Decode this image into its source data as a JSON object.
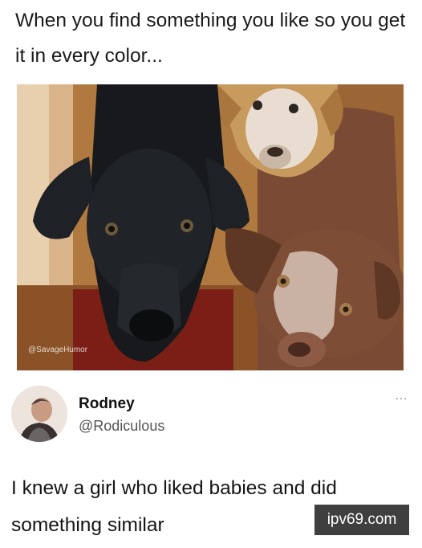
{
  "meme": {
    "caption": "When you find something you like so you get it in every color...",
    "watermark": "@SavageHumor"
  },
  "post": {
    "author_name": "Rodney",
    "author_handle": "@Rodiculous",
    "more_icon": "…",
    "text": "I knew a girl who liked babies and did something similar"
  },
  "site_badge": "ipv69.com",
  "colors": {
    "black_dog": "#17191c",
    "white_dog": "#e8ddd0",
    "brown_dog": "#7d4d36",
    "badge_bg": "#3f3f3f"
  }
}
